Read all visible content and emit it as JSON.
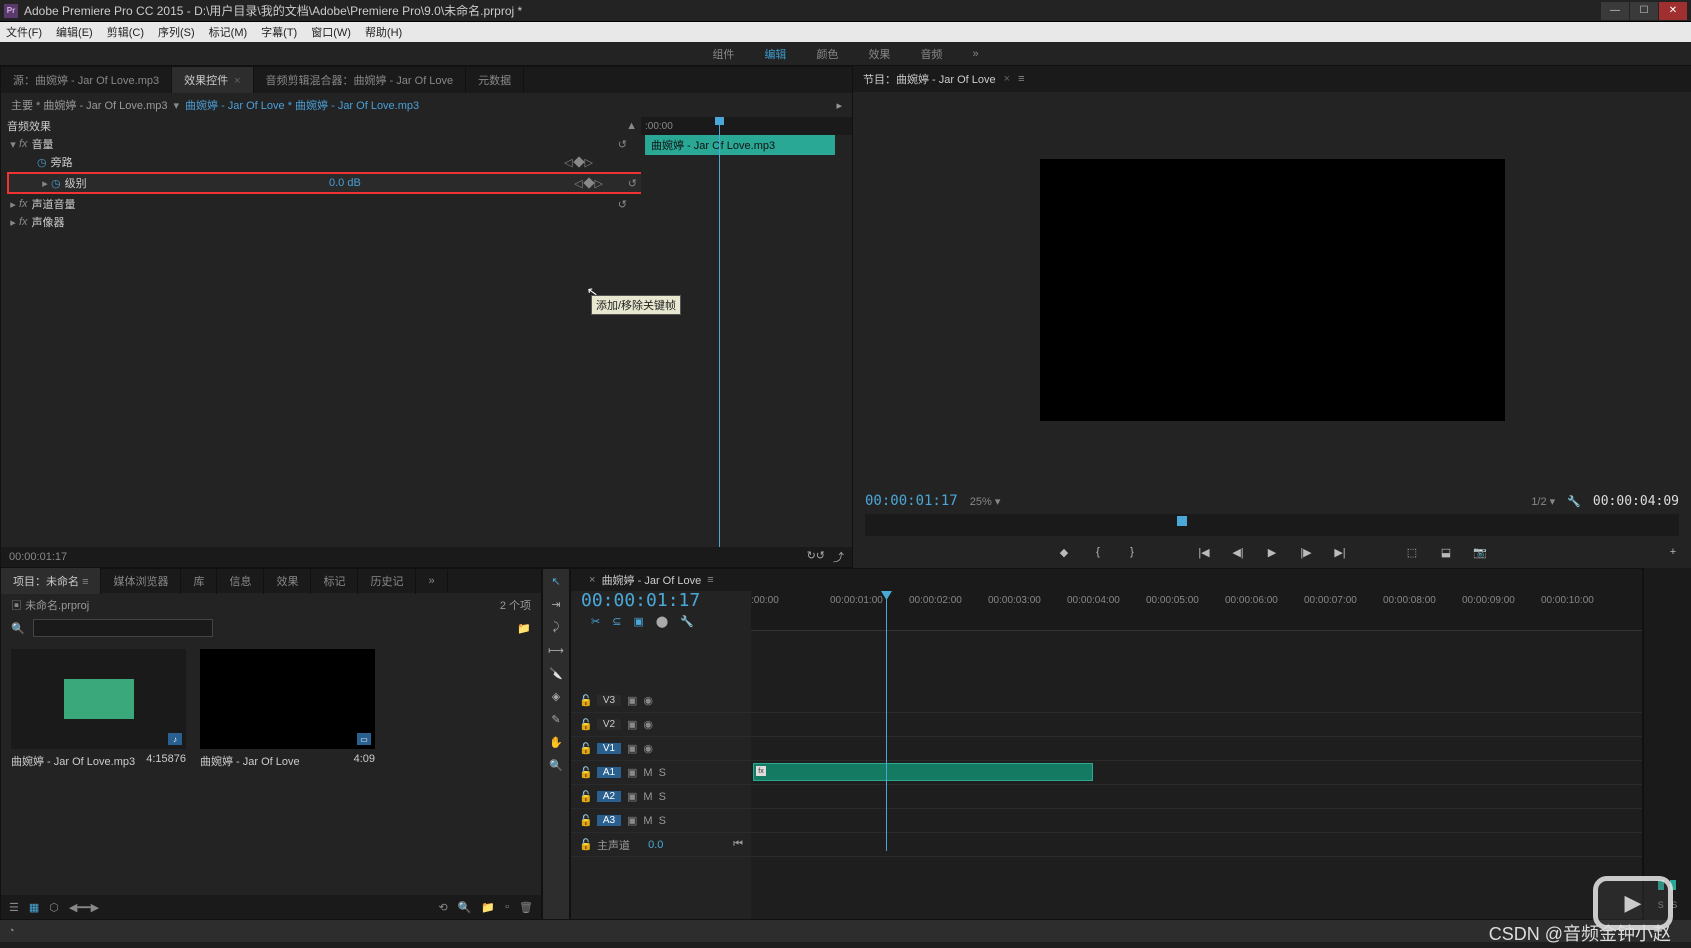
{
  "title_bar": {
    "app_icon_text": "Pr",
    "title": "Adobe Premiere Pro CC 2015 - D:\\用户目录\\我的文档\\Adobe\\Premiere Pro\\9.0\\未命名.prproj *"
  },
  "menu": {
    "file": "文件(F)",
    "edit": "编辑(E)",
    "clip": "剪辑(C)",
    "sequence": "序列(S)",
    "marker": "标记(M)",
    "title": "字幕(T)",
    "window": "窗口(W)",
    "help": "帮助(H)"
  },
  "workspaces": {
    "assembly": "组件",
    "editing": "编辑",
    "color": "颜色",
    "effects": "效果",
    "audio": "音频",
    "more": "»"
  },
  "source_tabs": {
    "source": "源：曲婉婷 - Jar Of Love.mp3",
    "effect_controls": "效果控件",
    "audio_mixer": "音频剪辑混合器：曲婉婷 - Jar Of Love",
    "metadata": "元数据"
  },
  "effect_controls": {
    "master_label": "主要 * 曲婉婷 - Jar Of Love.mp3",
    "clip_path": "曲婉婷 - Jar Of Love * 曲婉婷 - Jar Of Love.mp3",
    "section_audio": "音频效果",
    "volume": "音量",
    "bypass": "旁路",
    "level": "级别",
    "level_value": "0.0 dB",
    "channel_volume": "声道音量",
    "panner": "声像器",
    "mini_time": ":00:00",
    "mini_clip": "曲婉婷 - Jar Of Love.mp3",
    "tooltip": "添加/移除关键帧",
    "footer_tc": "00:00:01:17"
  },
  "program": {
    "title": "节目：曲婉婷 - Jar Of Love",
    "tc_current": "00:00:01:17",
    "zoom": "25%",
    "resolution": "1/2",
    "tc_duration": "00:00:04:09"
  },
  "project": {
    "tabs": {
      "project": "项目：未命名",
      "media_browser": "媒体浏览器",
      "libraries": "库",
      "info": "信息",
      "effects": "效果",
      "markers": "标记",
      "history": "历史记",
      "more": "»"
    },
    "bin_name": "未命名.prproj",
    "item_count": "2 个项",
    "items": [
      {
        "name": "曲婉婷 - Jar Of Love.mp3",
        "duration": "4:15876"
      },
      {
        "name": "曲婉婷 - Jar Of Love",
        "duration": "4:09"
      }
    ]
  },
  "timeline": {
    "title": "曲婉婷 - Jar Of Love",
    "tc": "00:00:01:17",
    "ruler": [
      ":00:00",
      "00:00:01:00",
      "00:00:02:00",
      "00:00:03:00",
      "00:00:04:00",
      "00:00:05:00",
      "00:00:06:00",
      "00:00:07:00",
      "00:00:08:00",
      "00:00:09:00",
      "00:00:10:00"
    ],
    "tracks": {
      "v3": "V3",
      "v2": "V2",
      "v1": "V1",
      "a1": "A1",
      "a2": "A2",
      "a3": "A3",
      "master": "主声道",
      "master_val": "0.0"
    }
  },
  "watermark": "CSDN @音频金钟小赵",
  "icons": {
    "search": "🔍",
    "folder": "📁",
    "reset": "↺",
    "play": "▶",
    "prev_kf": "◁",
    "next_kf": "▷",
    "diamond": "◆",
    "triangle_r": "▸",
    "triangle_d": "▾",
    "close_x": "×",
    "menu": "≡",
    "wrench": "🔧",
    "scissors": "✂",
    "step_back": "◀|",
    "step_fwd": "|▶",
    "goto_in": "|◀",
    "goto_out": "▶|",
    "mark_in": "{",
    "mark_out": "}",
    "marker": "◆",
    "lift": "⬚",
    "extract": "⬓",
    "camera": "📷",
    "plus": "+",
    "lock": "🔒",
    "eye": "👁",
    "mute": "M",
    "solo": "S",
    "link": "🔗",
    "list": "☰",
    "grid": "▦",
    "new": "▫",
    "trash": "🗑",
    "find": "🔍"
  }
}
